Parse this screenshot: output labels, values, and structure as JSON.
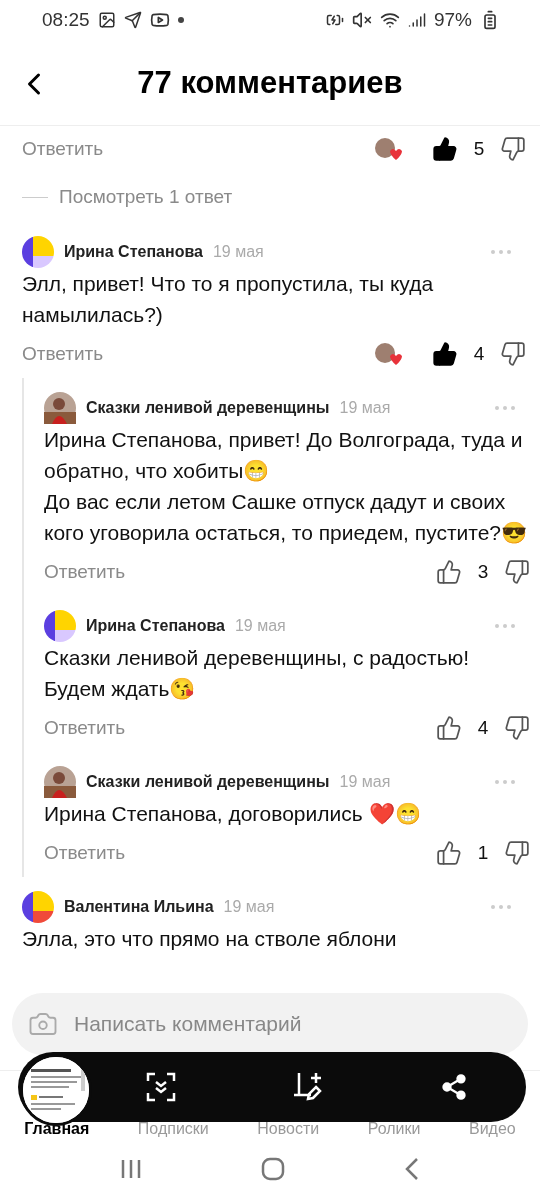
{
  "status_bar": {
    "time": "08:25",
    "battery": "97%"
  },
  "header": {
    "title": "77 комментариев"
  },
  "top_actions": {
    "reply": "Ответить",
    "has_reaction": true,
    "liked": true,
    "likes": "5"
  },
  "view_replies": "Посмотреть 1 ответ",
  "comments": [
    {
      "author": "Ирина Степанова",
      "date": "19 мая",
      "avatar": {
        "kind": "tiles",
        "color": "#d9c8ff"
      },
      "text": "Элл, привет! Что то я пропустила, ты куда намылилась?)",
      "reply": "Ответить",
      "has_reaction": true,
      "liked": true,
      "likes": "4",
      "replies": [
        {
          "author": "Сказки ленивой деревенщины",
          "date": "19 мая",
          "text": "Ирина Степанова, привет! До Волгограда, туда и обратно, что хобиты😁\nДо вас если летом Сашке отпуск дадут и своих кого уговорила остаться, то приедем, пустите?😎",
          "reply": "Ответить",
          "liked": false,
          "likes": "3"
        },
        {
          "author": "Ирина Степанова",
          "date": "19 мая",
          "avatar": {
            "kind": "tiles",
            "color": "#d9c8ff"
          },
          "text": "Сказки ленивой деревенщины, с радостью! Будем ждать😘",
          "reply": "Ответить",
          "liked": false,
          "likes": "4"
        },
        {
          "author": "Сказки ленивой деревенщины",
          "date": "19 мая",
          "text": "Ирина Степанова, договорились ❤️😁",
          "reply": "Ответить",
          "liked": false,
          "likes": "1"
        }
      ]
    },
    {
      "author": "Валентина Ильина",
      "date": "19 мая",
      "avatar": {
        "kind": "tiles",
        "color": "#f04a3a"
      },
      "text": "Элла, это что прямо на стволе яблони"
    }
  ],
  "comment_input": {
    "placeholder": "Написать комментарий"
  },
  "bottom_nav": [
    {
      "label": "Главная",
      "selected": true
    },
    {
      "label": "Подписки",
      "selected": false
    },
    {
      "label": "Новости",
      "selected": false
    },
    {
      "label": "Ролики",
      "selected": false
    },
    {
      "label": "Видео",
      "selected": false
    }
  ]
}
